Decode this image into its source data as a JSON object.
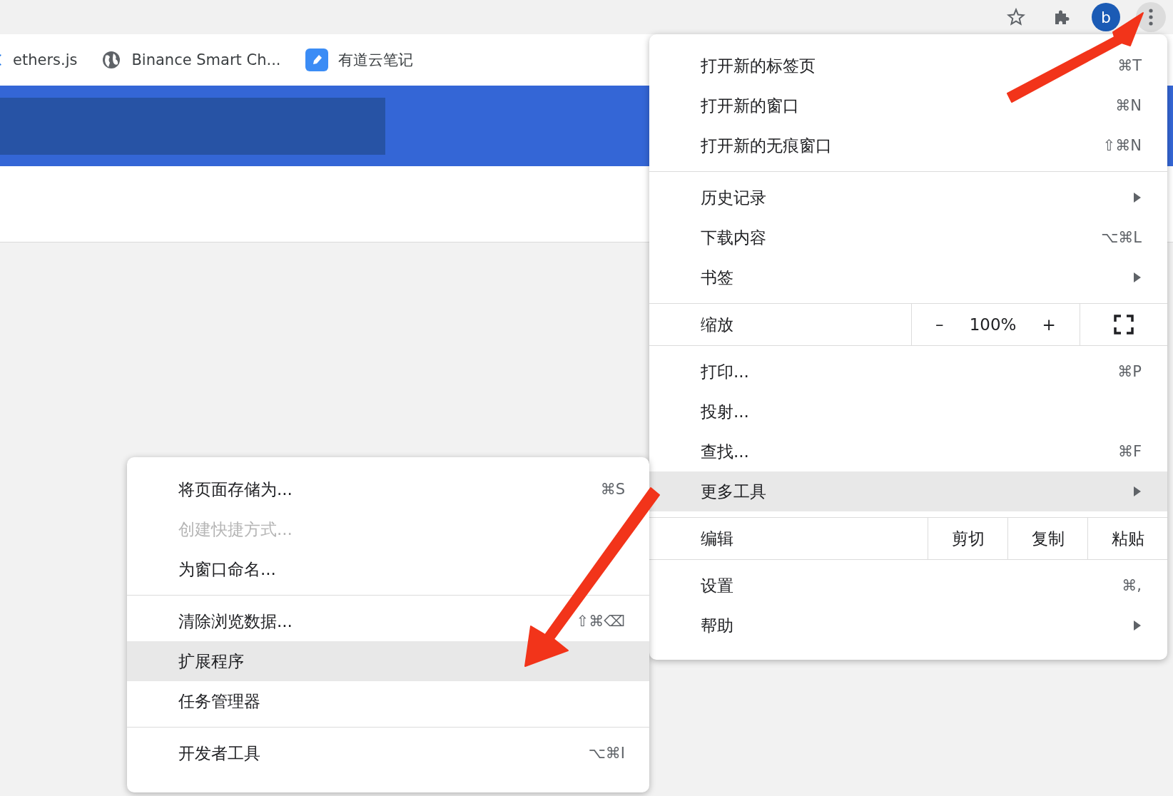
{
  "toolbar": {
    "avatar": "b"
  },
  "bookmarks": [
    {
      "kind": "ethers",
      "label": "ethers.js"
    },
    {
      "kind": "globe",
      "label": "Binance Smart Ch..."
    },
    {
      "kind": "note",
      "label": "有道云笔记"
    }
  ],
  "menu": {
    "groups": [
      [
        {
          "kind": "command",
          "label": "打开新的标签页",
          "shortcut": "⌘T",
          "disabled": false,
          "highlighted": false
        },
        {
          "kind": "command",
          "label": "打开新的窗口",
          "shortcut": "⌘N",
          "disabled": false,
          "highlighted": false
        },
        {
          "kind": "command",
          "label": "打开新的无痕窗口",
          "shortcut": "⇧⌘N",
          "disabled": false,
          "highlighted": false
        }
      ],
      [
        {
          "kind": "submenu",
          "label": "历史记录",
          "disabled": false,
          "highlighted": false
        },
        {
          "kind": "command",
          "label": "下载内容",
          "shortcut": "⌥⌘L",
          "disabled": false,
          "highlighted": false
        },
        {
          "kind": "submenu",
          "label": "书签",
          "disabled": false,
          "highlighted": false
        }
      ],
      [
        {
          "kind": "zoom",
          "label": "缩放",
          "minus": "–",
          "value": "100%",
          "plus": "+"
        }
      ],
      [
        {
          "kind": "command",
          "label": "打印...",
          "shortcut": "⌘P",
          "disabled": false,
          "highlighted": false
        },
        {
          "kind": "command",
          "label": "投射...",
          "disabled": false,
          "highlighted": false
        },
        {
          "kind": "command",
          "label": "查找...",
          "shortcut": "⌘F",
          "disabled": false,
          "highlighted": false
        },
        {
          "kind": "submenu",
          "label": "更多工具",
          "disabled": false,
          "highlighted": true
        }
      ],
      [
        {
          "kind": "edit",
          "label": "编辑",
          "buttons": [
            "剪切",
            "复制",
            "粘贴"
          ]
        }
      ],
      [
        {
          "kind": "command",
          "label": "设置",
          "shortcut": "⌘,",
          "disabled": false,
          "highlighted": false
        },
        {
          "kind": "submenu",
          "label": "帮助",
          "disabled": false,
          "highlighted": false
        }
      ]
    ]
  },
  "submenu": {
    "groups": [
      [
        {
          "kind": "command",
          "label": "将页面存储为...",
          "shortcut": "⌘S",
          "disabled": false,
          "highlighted": false
        },
        {
          "kind": "command",
          "label": "创建快捷方式...",
          "disabled": true,
          "highlighted": false
        },
        {
          "kind": "command",
          "label": "为窗口命名...",
          "disabled": false,
          "highlighted": false
        }
      ],
      [
        {
          "kind": "command",
          "label": "清除浏览数据...",
          "shortcut": "⇧⌘⌫",
          "disabled": false,
          "highlighted": false
        },
        {
          "kind": "command",
          "label": "扩展程序",
          "disabled": false,
          "highlighted": true
        },
        {
          "kind": "command",
          "label": "任务管理器",
          "disabled": false,
          "highlighted": false
        }
      ],
      [
        {
          "kind": "command",
          "label": "开发者工具",
          "shortcut": "⌥⌘I",
          "disabled": false,
          "highlighted": false
        }
      ]
    ]
  }
}
